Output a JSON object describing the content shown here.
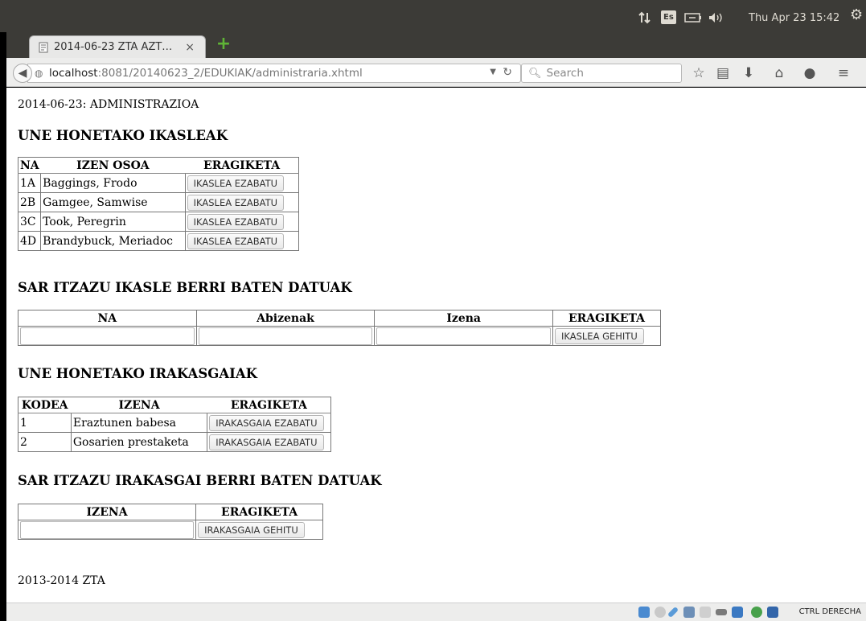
{
  "os": {
    "keyboard": "Es",
    "clock": "Thu Apr 23 15:42"
  },
  "browser": {
    "tab_title": "2014-06-23 ZTA AZT…",
    "tab_close": "×",
    "new_tab": "+",
    "url_host": "localhost",
    "url_rest": ":8081/20140623_2/EDUKIAK/administraria.xhtml",
    "search_placeholder": "Search"
  },
  "page": {
    "header": "2014-06-23: ADMINISTRAZIOA",
    "students": {
      "title": "UNE HONETAKO IKASLEAK",
      "columns": [
        "NA",
        "IZEN OSOA",
        "ERAGIKETA"
      ],
      "rows": [
        {
          "na": "1A",
          "name": "Baggings, Frodo",
          "action": "IKASLEA EZABATU"
        },
        {
          "na": "2B",
          "name": "Gamgee, Samwise",
          "action": "IKASLEA EZABATU"
        },
        {
          "na": "3C",
          "name": "Took, Peregrin",
          "action": "IKASLEA EZABATU"
        },
        {
          "na": "4D",
          "name": "Brandybuck, Meriadoc",
          "action": "IKASLEA EZABATU"
        }
      ]
    },
    "new_student": {
      "title": "SAR ITZAZU IKASLE BERRI BATEN DATUAK",
      "columns": [
        "NA",
        "Abizenak",
        "Izena",
        "ERAGIKETA"
      ],
      "button": "IKASLEA GEHITU"
    },
    "subjects": {
      "title": "UNE HONETAKO IRAKASGAIAK",
      "columns": [
        "KODEA",
        "IZENA",
        "ERAGIKETA"
      ],
      "rows": [
        {
          "code": "1",
          "name": "Eraztunen babesa",
          "action": "IRAKASGAIA EZABATU"
        },
        {
          "code": "2",
          "name": "Gosarien prestaketa",
          "action": "IRAKASGAIA EZABATU"
        }
      ]
    },
    "new_subject": {
      "title": "SAR ITZAZU IRAKASGAI BERRI BATEN DATUAK",
      "columns": [
        "IZENA",
        "ERAGIKETA"
      ],
      "button": "IRAKASGAIA GEHITU"
    },
    "footer": "2013-2014 ZTA"
  },
  "statusbar": {
    "text": "CTRL DERECHA"
  }
}
